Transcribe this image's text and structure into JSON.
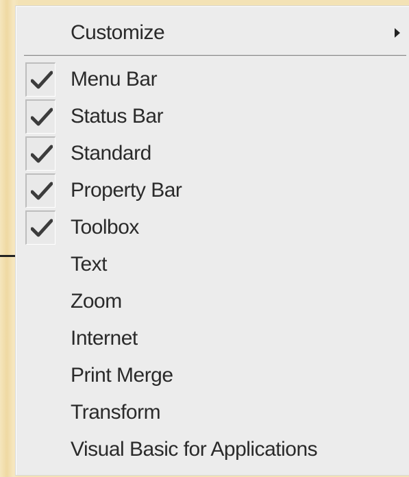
{
  "menu": {
    "customize": {
      "label": "Customize",
      "has_submenu": true
    },
    "items": [
      {
        "label": "Menu Bar",
        "checked": true
      },
      {
        "label": "Status Bar",
        "checked": true
      },
      {
        "label": "Standard",
        "checked": true
      },
      {
        "label": "Property Bar",
        "checked": true
      },
      {
        "label": "Toolbox",
        "checked": true
      },
      {
        "label": "Text",
        "checked": false
      },
      {
        "label": "Zoom",
        "checked": false
      },
      {
        "label": "Internet",
        "checked": false
      },
      {
        "label": "Print Merge",
        "checked": false
      },
      {
        "label": "Transform",
        "checked": false
      },
      {
        "label": "Visual Basic for Applications",
        "checked": false
      }
    ]
  },
  "icons": {
    "check": "checkmark-icon",
    "submenu": "triangle-right-icon"
  },
  "colors": {
    "menu_background": "#ececec",
    "text": "#2a2a2a",
    "backdrop": "#f2e1b3"
  }
}
